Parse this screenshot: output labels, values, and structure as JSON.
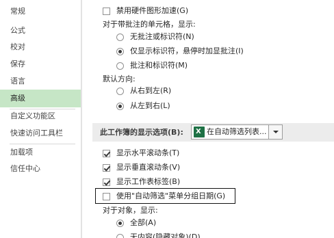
{
  "sidebar": {
    "items": [
      {
        "label": "常规"
      },
      {
        "label": "公式"
      },
      {
        "label": "校对"
      },
      {
        "label": "保存"
      },
      {
        "label": "语言"
      },
      {
        "label": "高级"
      },
      {
        "label": "自定义功能区"
      },
      {
        "label": "快速访问工具栏"
      },
      {
        "label": "加载项"
      },
      {
        "label": "信任中心"
      }
    ],
    "selected": "高级"
  },
  "content": {
    "hw_accel": {
      "label": "禁用硬件图形加速(G)",
      "checked": false
    },
    "comment_heading": "对于带批注的单元格，显示:",
    "comment_options": [
      {
        "label": "无批注或标识符(N)",
        "selected": false
      },
      {
        "label": "仅显示标识符，悬停时加显批注(I)",
        "selected": true
      },
      {
        "label": "批注和标识符(M)",
        "selected": false
      }
    ],
    "direction_heading": "默认方向:",
    "direction_options": [
      {
        "label": "从右到左(R)",
        "selected": false
      },
      {
        "label": "从左到右(L)",
        "selected": true
      }
    ],
    "workbook_section": {
      "title": "此工作簿的显示选项(B):",
      "select_value": "在自动筛选列表...",
      "select_icon": "excel-workbook-icon"
    },
    "display_options": [
      {
        "label": "显示水平滚动条(T)",
        "checked": true
      },
      {
        "label": "显示垂直滚动条(V)",
        "checked": true
      },
      {
        "label": "显示工作表标签(B)",
        "checked": true
      },
      {
        "label": "使用\"自动筛选\"菜单分组日期(G)",
        "checked": false
      }
    ],
    "objects_heading": "对于对象，显示:",
    "objects_options": [
      {
        "label": "全部(A)",
        "selected": true
      },
      {
        "label": "无内容(隐藏对象)(D)",
        "selected": false
      }
    ]
  },
  "colors": {
    "selected_sidebar_bg": "#c6e6c6",
    "section_band_bg": "#ececec",
    "excel_green": "#1e7145"
  }
}
